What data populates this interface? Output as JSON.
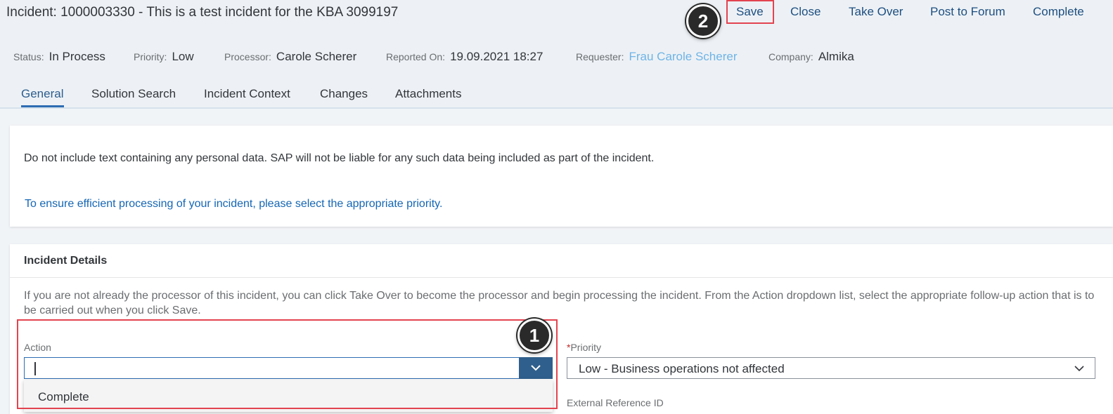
{
  "header": {
    "title": "Incident: 1000003330 - This is a test incident for the KBA 3099197",
    "actions": [
      {
        "label": "Save"
      },
      {
        "label": "Close"
      },
      {
        "label": "Take Over"
      },
      {
        "label": "Post to Forum"
      },
      {
        "label": "Complete"
      }
    ],
    "markers": {
      "one": "1",
      "two": "2"
    }
  },
  "meta": {
    "status": {
      "label": "Status:",
      "value": "In Process"
    },
    "priority": {
      "label": "Priority:",
      "value": "Low"
    },
    "processor": {
      "label": "Processor:",
      "value": "Carole Scherer"
    },
    "reported": {
      "label": "Reported On:",
      "value": "19.09.2021 18:27"
    },
    "requester": {
      "label": "Requester:",
      "value": "Frau Carole Scherer"
    },
    "company": {
      "label": "Company:",
      "value": "Almika"
    }
  },
  "tabs": [
    {
      "label": "General",
      "active": true
    },
    {
      "label": "Solution Search"
    },
    {
      "label": "Incident Context"
    },
    {
      "label": "Changes"
    },
    {
      "label": "Attachments"
    }
  ],
  "notice": {
    "text": "Do not include text containing any personal data. SAP will not be liable for any such data being included as part of the incident.",
    "priority_hint": "To ensure efficient processing of your incident, please select the appropriate priority."
  },
  "details": {
    "title": "Incident Details",
    "info": "If you are not already the processor of this incident, you can click Take Over to become the processor and begin processing the incident. From the Action dropdown list, select the appropriate follow-up action that is to be carried out when you click Save.",
    "action": {
      "label": "Action",
      "value": "",
      "options": [
        "Complete"
      ]
    },
    "priority": {
      "required_mark": "*",
      "label": "Priority",
      "value": "Low - Business operations not affected"
    },
    "external_ref": {
      "label": "External Reference ID"
    }
  },
  "colors": {
    "link": "#1e4f80",
    "highlight": "#e34450",
    "dropdown_button": "#2f5f8c"
  }
}
